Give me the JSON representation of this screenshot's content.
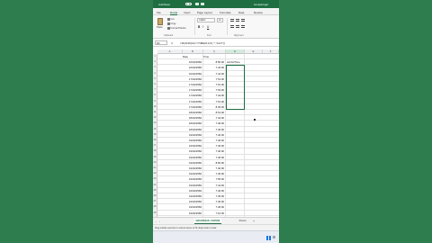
{
  "app": {
    "autosave_label": "AutoSave",
    "autosave_state": "Off",
    "doc_title": "sunsplunger"
  },
  "ribbon": {
    "tabs": [
      "File",
      "Home",
      "Insert",
      "Page Layout",
      "Formulas",
      "Data",
      "Review"
    ],
    "active_tab": "Home",
    "clipboard": {
      "paste": "Paste",
      "cut": "Cut",
      "copy": "Copy",
      "format_painter": "Format Painter",
      "group_label": "Clipboard"
    },
    "font": {
      "family": "Calibri",
      "size": "11",
      "bold": "B",
      "italic": "I",
      "underline": "U",
      "group_label": "Font"
    },
    "alignment_label": "Alignment"
  },
  "formula_bar": {
    "name_box": "D2",
    "fx": "fx",
    "formula": "=IF(AND(C2<=TIME(8,0,0),\"\",\"ALO\"))"
  },
  "grid": {
    "columns": [
      "A",
      "B",
      "C",
      "D",
      "E",
      "F"
    ],
    "selected_column": "D",
    "header_row": {
      "row": "1",
      "a": "",
      "b": "Date",
      "c": "Time",
      "d": ""
    },
    "rows": [
      {
        "row": "2",
        "b": "16/02/2566",
        "c": "8:50:00",
        "d": "ALOG/Time"
      },
      {
        "row": "3",
        "b": "16/02/2566",
        "c": "7:44:00",
        "d": ""
      },
      {
        "row": "4",
        "b": "16/02/2566",
        "c": "7:44:00",
        "d": ""
      },
      {
        "row": "5",
        "b": "17/02/2566",
        "c": "7:51:00",
        "d": ""
      },
      {
        "row": "6",
        "b": "17/02/2566",
        "c": "7:51:00",
        "d": ""
      },
      {
        "row": "7",
        "b": "17/02/2566",
        "c": "7:54:00",
        "d": ""
      },
      {
        "row": "8",
        "b": "17/02/2566",
        "c": "7:44:00",
        "d": ""
      },
      {
        "row": "9",
        "b": "17/02/2566",
        "c": "7:51:00",
        "d": ""
      },
      {
        "row": "10",
        "b": "17/02/2566",
        "c": "8:45:00",
        "d": ""
      },
      {
        "row": "11",
        "b": "18/02/2566",
        "c": "8:51:00",
        "d": ""
      },
      {
        "row": "12",
        "b": "18/02/2566",
        "c": "7:44:00",
        "d": ""
      },
      {
        "row": "13",
        "b": "18/02/2566",
        "c": "7:46:00",
        "d": ""
      },
      {
        "row": "14",
        "b": "18/02/2566",
        "c": "7:46:00",
        "d": ""
      },
      {
        "row": "15",
        "b": "19/02/2566",
        "c": "7:40:00",
        "d": ""
      },
      {
        "row": "16",
        "b": "19/02/2566",
        "c": "7:46:00",
        "d": ""
      },
      {
        "row": "17",
        "b": "19/02/2566",
        "c": "7:46:00",
        "d": ""
      },
      {
        "row": "18",
        "b": "19/02/2566",
        "c": "7:40:00",
        "d": ""
      },
      {
        "row": "19",
        "b": "19/02/2566",
        "c": "7:46:00",
        "d": ""
      },
      {
        "row": "20",
        "b": "19/02/2566",
        "c": "8:50:00",
        "d": ""
      },
      {
        "row": "21",
        "b": "19/02/2566",
        "c": "7:40:00",
        "d": ""
      },
      {
        "row": "22",
        "b": "19/02/2566",
        "c": "7:46:00",
        "d": ""
      },
      {
        "row": "23",
        "b": "19/02/2566",
        "c": "7:55:00",
        "d": ""
      },
      {
        "row": "24",
        "b": "19/02/2566",
        "c": "7:44:00",
        "d": ""
      },
      {
        "row": "25",
        "b": "19/02/2566",
        "c": "7:46:00",
        "d": ""
      },
      {
        "row": "26",
        "b": "19/02/2566",
        "c": "7:45:00",
        "d": ""
      },
      {
        "row": "27",
        "b": "19/02/2566",
        "c": "7:46:00",
        "d": ""
      },
      {
        "row": "28",
        "b": "19/02/2566",
        "c": "7:46:00",
        "d": ""
      },
      {
        "row": "29",
        "b": "19/02/2566",
        "c": "7:10:00",
        "d": ""
      },
      {
        "row": "30",
        "b": "19/02/2566",
        "c": "7:10:00",
        "d": ""
      }
    ]
  },
  "sheets": {
    "tabs": [
      "09/12/66th/Fr 21/25/66",
      "Sheet1"
    ],
    "active": "09/12/66th/Fr 21/25/66",
    "add": "+"
  },
  "status_bar": {
    "text": "Drag outside selection to extend series or fill; drag inside to clear"
  },
  "colors": {
    "excel_green": "#1e6e42",
    "background": "#2e7d4f",
    "windows_blue": "#1a73e8"
  },
  "icons": [
    "paste-icon",
    "cut-icon",
    "copy-icon",
    "format-painter-icon",
    "align-icon",
    "windows-logo-icon"
  ]
}
